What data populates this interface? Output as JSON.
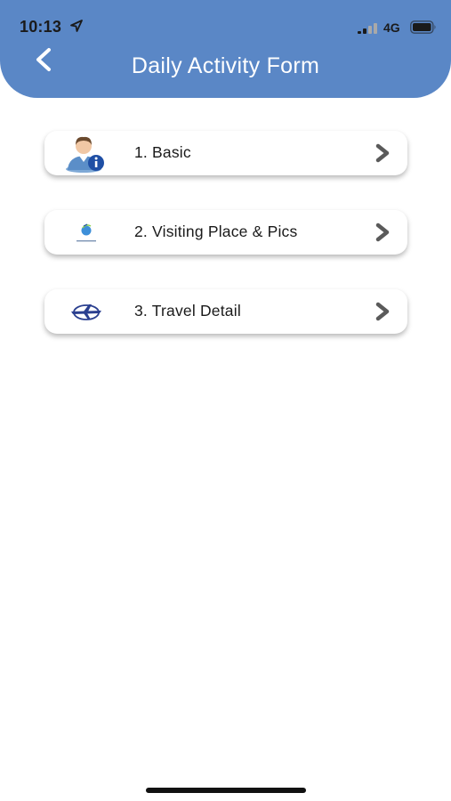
{
  "status_bar": {
    "time": "10:13",
    "network": "4G",
    "location_icon": "location-arrow-icon",
    "signal_icon": "cellular-signal-icon",
    "battery_icon": "battery-icon"
  },
  "header": {
    "title": "Daily Activity Form",
    "back_icon": "chevron-left-icon",
    "background_color": "#5a87c6"
  },
  "menu": {
    "items": [
      {
        "label": "1. Basic",
        "icon": "user-info-icon"
      },
      {
        "label": "2. Visiting Place & Pics",
        "icon": "travel-logo-icon"
      },
      {
        "label": "3. Travel Detail",
        "icon": "airplane-logo-icon"
      }
    ],
    "chevron_icon": "chevron-right-icon"
  }
}
